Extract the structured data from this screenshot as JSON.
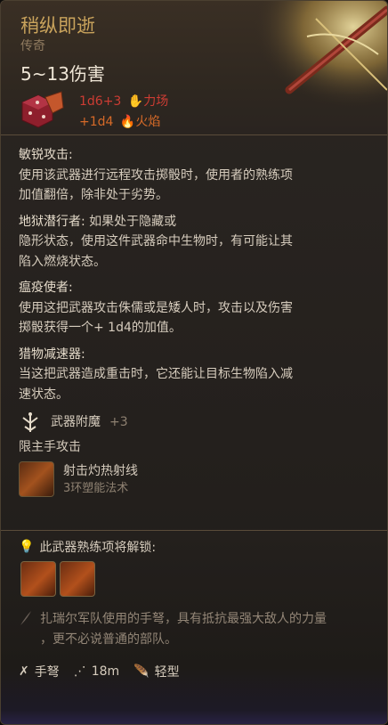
{
  "item": {
    "name": "稍纵即逝",
    "rarity": "传奇",
    "damage_range": "5~13伤害",
    "damage_rows": [
      {
        "dice": "1d6+3",
        "type": "力场",
        "color": "#cc3c33",
        "icon": "force-icon"
      },
      {
        "dice": "+1d4",
        "type": "火焰",
        "color": "#d66a28",
        "icon": "fire-icon"
      }
    ]
  },
  "abilities": [
    {
      "title": "敏锐攻击:",
      "text_lines": [
        "使用该武器进行远程攻击掷骰时，使用者的熟练项",
        "加值翻倍，除非处于劣势。"
      ]
    },
    {
      "title": "地狱潜行者:",
      "title_tail": " 如果处于隐藏或",
      "text_lines": [
        "隐形状态，使用这件武器命中生物时，有可能让其",
        "陷入燃烧状态。"
      ]
    },
    {
      "title": "瘟疫使者:",
      "text_lines": [
        "使用这把武器攻击侏儒或是矮人时，攻击以及伤害",
        "掷骰获得一个+ 1d4的加值。"
      ]
    },
    {
      "title": "猎物减速器:",
      "text_lines": [
        "当这把武器造成重击时，它还能让目标生物陷入减",
        "速状态。"
      ]
    }
  ],
  "enchantment": {
    "label": "武器附魔",
    "value": "+3"
  },
  "mainhand_note": "限主手攻击",
  "spell": {
    "name": "射击灼热射线",
    "level": "3环塑能法术"
  },
  "proficiency_unlock": "此武器熟练项将解锁:",
  "flavor_lines": [
    "扎瑞尔军队使用的手弩，具有抵抗最强大敌人的力量",
    "，更不必说普通的部队。"
  ],
  "properties": [
    {
      "icon": "crossbow-icon",
      "label": "手弩"
    },
    {
      "icon": "range-icon",
      "label": "18m"
    },
    {
      "icon": "feather-icon",
      "label": "轻型"
    }
  ],
  "colors": {
    "accent_gold": "#c9a35c",
    "force_red": "#cc3c33",
    "fire_orange": "#d66a28"
  }
}
